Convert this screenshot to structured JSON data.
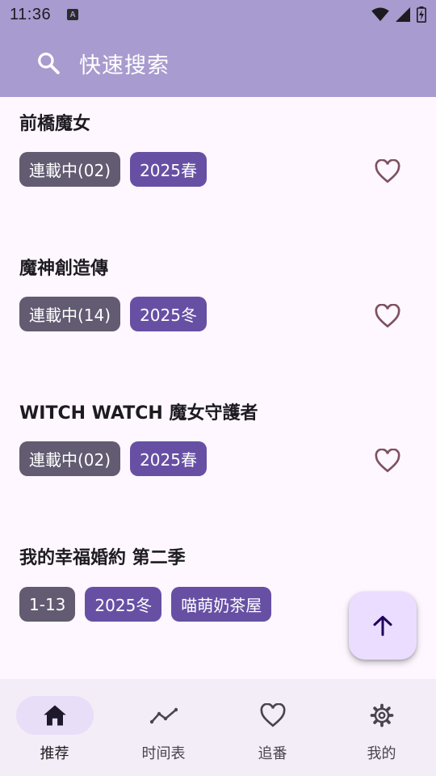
{
  "status_bar": {
    "time": "11:36",
    "app_icon_letter": "A"
  },
  "search": {
    "placeholder": "快速搜索"
  },
  "anime_list": [
    {
      "title": "前橋魔女",
      "tags": [
        "連載中(02)",
        "2025春"
      ],
      "favorited": false
    },
    {
      "title": "魔神創造傳",
      "tags": [
        "連載中(14)",
        "2025冬"
      ],
      "favorited": false
    },
    {
      "title": "WITCH WATCH 魔女守護者",
      "tags": [
        "連載中(02)",
        "2025春"
      ],
      "favorited": false
    },
    {
      "title": "我的幸福婚約 第二季",
      "tags": [
        "1-13",
        "2025冬",
        "喵萌奶茶屋"
      ],
      "favorited": false
    }
  ],
  "bottom_nav": [
    {
      "label": "推荐",
      "icon": "home-icon",
      "active": true
    },
    {
      "label": "时间表",
      "icon": "timeline-icon",
      "active": false
    },
    {
      "label": "追番",
      "icon": "heart-icon",
      "active": false
    },
    {
      "label": "我的",
      "icon": "gear-icon",
      "active": false
    }
  ],
  "colors": {
    "header": "#A89BCF",
    "background": "#FEF7FF",
    "tag_status": "#625B71",
    "tag_season": "#6750A4",
    "fab": "#EADDFF",
    "nav_bg": "#F3EDF7",
    "nav_active": "#E8DEF8"
  }
}
